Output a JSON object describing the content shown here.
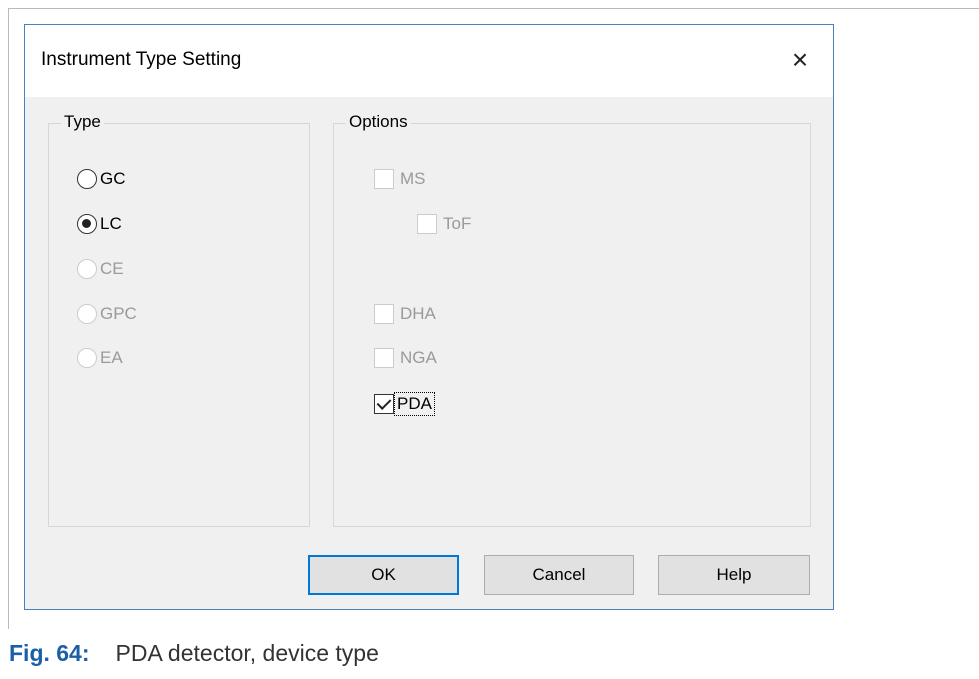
{
  "dialog": {
    "title": "Instrument Type Setting",
    "close_symbol": "×"
  },
  "type_group": {
    "label": "Type",
    "options": [
      {
        "label": "GC",
        "checked": false,
        "enabled": true
      },
      {
        "label": "LC",
        "checked": true,
        "enabled": true
      },
      {
        "label": "CE",
        "checked": false,
        "enabled": false
      },
      {
        "label": "GPC",
        "checked": false,
        "enabled": false
      },
      {
        "label": "EA",
        "checked": false,
        "enabled": false
      }
    ]
  },
  "options_group": {
    "label": "Options",
    "items": [
      {
        "label": "MS",
        "checked": false,
        "enabled": false
      },
      {
        "label": "ToF",
        "checked": false,
        "enabled": false
      },
      {
        "label": "DHA",
        "checked": false,
        "enabled": false
      },
      {
        "label": "NGA",
        "checked": false,
        "enabled": false
      },
      {
        "label": "PDA",
        "checked": true,
        "enabled": true
      }
    ]
  },
  "buttons": {
    "ok": "OK",
    "cancel": "Cancel",
    "help": "Help"
  },
  "caption": {
    "figure": "Fig. 64:",
    "text": "PDA detector, device type"
  },
  "colors": {
    "accent": "#0078d7",
    "caption_blue": "#1a5fa8",
    "dialog_border": "#4a7fc1"
  }
}
